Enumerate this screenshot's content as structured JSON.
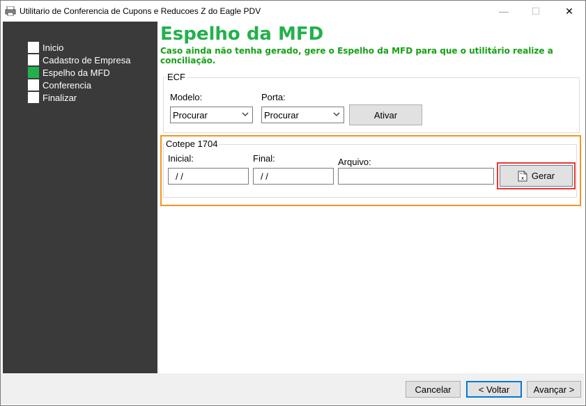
{
  "window": {
    "title": "Utilitario de Conferencia de Cupons e Reducoes Z do Eagle PDV",
    "minimize": "—",
    "maximize": "☐",
    "close": "✕"
  },
  "sidebar": {
    "items": [
      {
        "label": "Inicio",
        "active": false
      },
      {
        "label": "Cadastro de Empresa",
        "active": false
      },
      {
        "label": "Espelho da MFD",
        "active": true
      },
      {
        "label": "Conferencia",
        "active": false
      },
      {
        "label": "Finalizar",
        "active": false
      }
    ]
  },
  "page": {
    "title": "Espelho da MFD",
    "subtitle": "Caso ainda não tenha gerado, gere o Espelho da MFD para que o utilitário realize a conciliação."
  },
  "ecf": {
    "group_label": "ECF",
    "modelo_label": "Modelo:",
    "modelo_value": "Procurar",
    "porta_label": "Porta:",
    "porta_value": "Procurar",
    "ativar_label": "Ativar"
  },
  "cotepe": {
    "group_label": "Cotepe 1704",
    "inicial_label": "Inicial:",
    "inicial_value": " /  /",
    "final_label": "Final:",
    "final_value": " /  /",
    "arquivo_label": "Arquivo:",
    "arquivo_value": "",
    "gerar_label": "Gerar"
  },
  "footer": {
    "cancel_label": "Cancelar",
    "back_label": "< Voltar",
    "next_label": "Avançar >"
  },
  "colors": {
    "accent_green": "#22b14c",
    "highlight_orange": "#f7931e",
    "highlight_red": "#e53935"
  }
}
